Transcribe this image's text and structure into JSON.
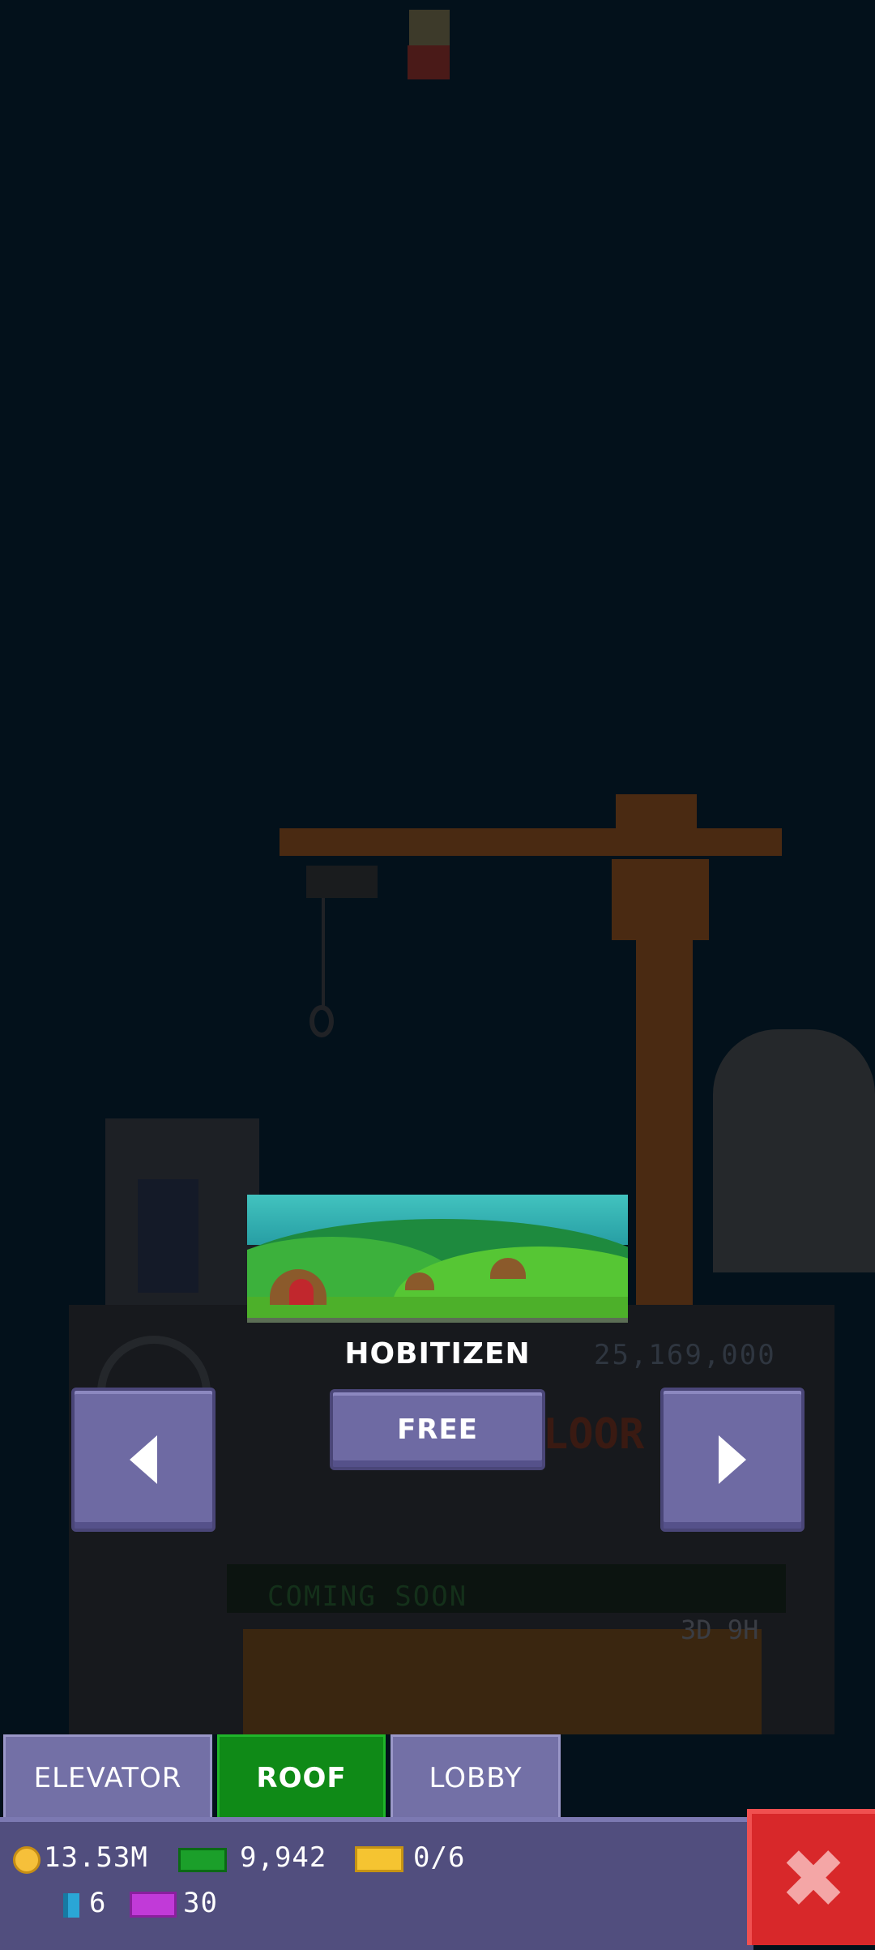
{
  "roof": {
    "name": "HOBITIZEN",
    "price": "25,169,000",
    "action_label": "FREE"
  },
  "background": {
    "floor_sign": "LOOR",
    "coming_soon": "COMING SOON",
    "timer": "3D 9H"
  },
  "tabs": [
    {
      "label": "ELEVATOR",
      "active": false
    },
    {
      "label": "ROOF",
      "active": true
    },
    {
      "label": "LOBBY",
      "active": false
    }
  ],
  "stats": {
    "coins": "13.53M",
    "bux": "9,942",
    "tickets": "0/6",
    "bits": "6",
    "vip": "30"
  },
  "icons": {
    "prev": "triangle-left-icon",
    "next": "triangle-right-icon",
    "close": "close-x-icon",
    "coin": "coin-icon",
    "bux": "bux-icon",
    "ticket": "ticket-icon",
    "bit": "bit-icon",
    "vip": "vip-icon"
  },
  "colors": {
    "background": "#03111b",
    "button": "#6e6aa3",
    "active_tab": "#0f8a17",
    "close_button": "#d8282a",
    "bottom_bar": "#514e7e"
  }
}
